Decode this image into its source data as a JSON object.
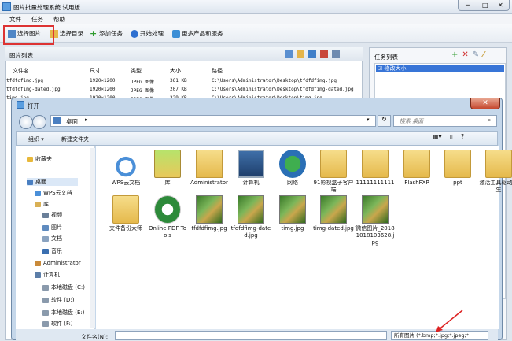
{
  "app": {
    "title": "图片批量处理系统 试用版"
  },
  "menu": [
    "文件",
    "任务",
    "帮助"
  ],
  "toolbar": {
    "select_images": "选择图片",
    "select_dir": "选择目录",
    "add_task": "添加任务",
    "start": "开始处理",
    "more": "更多产品和服务"
  },
  "image_list": {
    "title": "图片列表",
    "columns": [
      "文件名",
      "尺寸",
      "类型",
      "大小",
      "路径"
    ],
    "rows": [
      [
        "tfdfdfimg.jpg",
        "1920×1200",
        "JPEG 图像",
        "361 KB",
        "C:\\Users\\Administrator\\Desktop\\tfdfdfimg.jpg"
      ],
      [
        "tfdfdfimg-dated.jpg",
        "1920×1200",
        "JPEG 图像",
        "207 KB",
        "C:\\Users\\Administrator\\Desktop\\tfdfdfimg-dated.jpg"
      ],
      [
        "timg.jpg",
        "1920×1200",
        "JPEG 图像",
        "229 KB",
        "C:\\Users\\Administrator\\Desktop\\timg.jpg"
      ]
    ]
  },
  "task_list": {
    "title": "任务列表",
    "item": "修改大小",
    "checked": true
  },
  "dialog": {
    "title": "打开",
    "address": "桌面",
    "search_placeholder": "搜索 桌面",
    "organize": "组织 ▾",
    "new_folder": "新建文件夹",
    "close": "✕",
    "tree": [
      {
        "label": "收藏夹",
        "icon": "star-icon",
        "color": "#e8b83a"
      },
      {
        "label": "桌面",
        "icon": "desktop-icon",
        "color": "#4a7fc1"
      },
      {
        "label": "WPS云文档",
        "icon": "cloud-icon",
        "color": "#4a8fd8"
      },
      {
        "label": "库",
        "icon": "library-icon",
        "color": "#d9b055"
      },
      {
        "label": "视频",
        "icon": "video-icon",
        "color": "#6a7f99"
      },
      {
        "label": "图片",
        "icon": "picture-icon",
        "color": "#5f8bbf"
      },
      {
        "label": "文档",
        "icon": "document-icon",
        "color": "#8aa3c0"
      },
      {
        "label": "音乐",
        "icon": "music-icon",
        "color": "#3a6fb0"
      },
      {
        "label": "Administrator",
        "icon": "user-icon",
        "color": "#c98a3a"
      },
      {
        "label": "计算机",
        "icon": "computer-icon",
        "color": "#5c7ea8"
      },
      {
        "label": "本地磁盘 (C:)",
        "icon": "disk-icon",
        "color": "#8a9aac"
      },
      {
        "label": "软件 (D:)",
        "icon": "disk-icon",
        "color": "#8a9aac"
      },
      {
        "label": "本地磁盘 (E:)",
        "icon": "disk-icon",
        "color": "#8a9aac"
      },
      {
        "label": "软件 (F:)",
        "icon": "disk-icon",
        "color": "#8a9aac"
      }
    ],
    "items": [
      {
        "label": "WPS云文档",
        "icon": "cloud-icon"
      },
      {
        "label": "库",
        "icon": "library-icon"
      },
      {
        "label": "Administrator",
        "icon": "user-icon"
      },
      {
        "label": "计算机",
        "icon": "computer-icon"
      },
      {
        "label": "网络",
        "icon": "network-icon"
      },
      {
        "label": "91影视盒子客户端",
        "icon": "folder-icon"
      },
      {
        "label": "11111111111",
        "icon": "folder-icon"
      },
      {
        "label": "FlashFXP",
        "icon": "folder-icon"
      },
      {
        "label": "ppt",
        "icon": "folder-icon"
      },
      {
        "label": "激活工具驱动人生",
        "icon": "folder-icon"
      },
      {
        "label": "文件备份大师",
        "icon": "folder-icon"
      },
      {
        "label": "Online PDF Tools",
        "icon": "pdf-icon"
      },
      {
        "label": "tfdfdfimg.jpg",
        "icon": "image-icon"
      },
      {
        "label": "tfdfdfimg-dated.jpg",
        "icon": "image-icon"
      },
      {
        "label": "timg.jpg",
        "icon": "image-icon"
      },
      {
        "label": "timg-dated.jpg",
        "icon": "image-icon"
      },
      {
        "label": "微信图片_20181018103628.jpg",
        "icon": "image-icon"
      }
    ],
    "filename_label": "文件名(N):",
    "filename_value": "",
    "filetype": "所有图片 (*.bmp;*.jpg;*.jpeg;*"
  }
}
